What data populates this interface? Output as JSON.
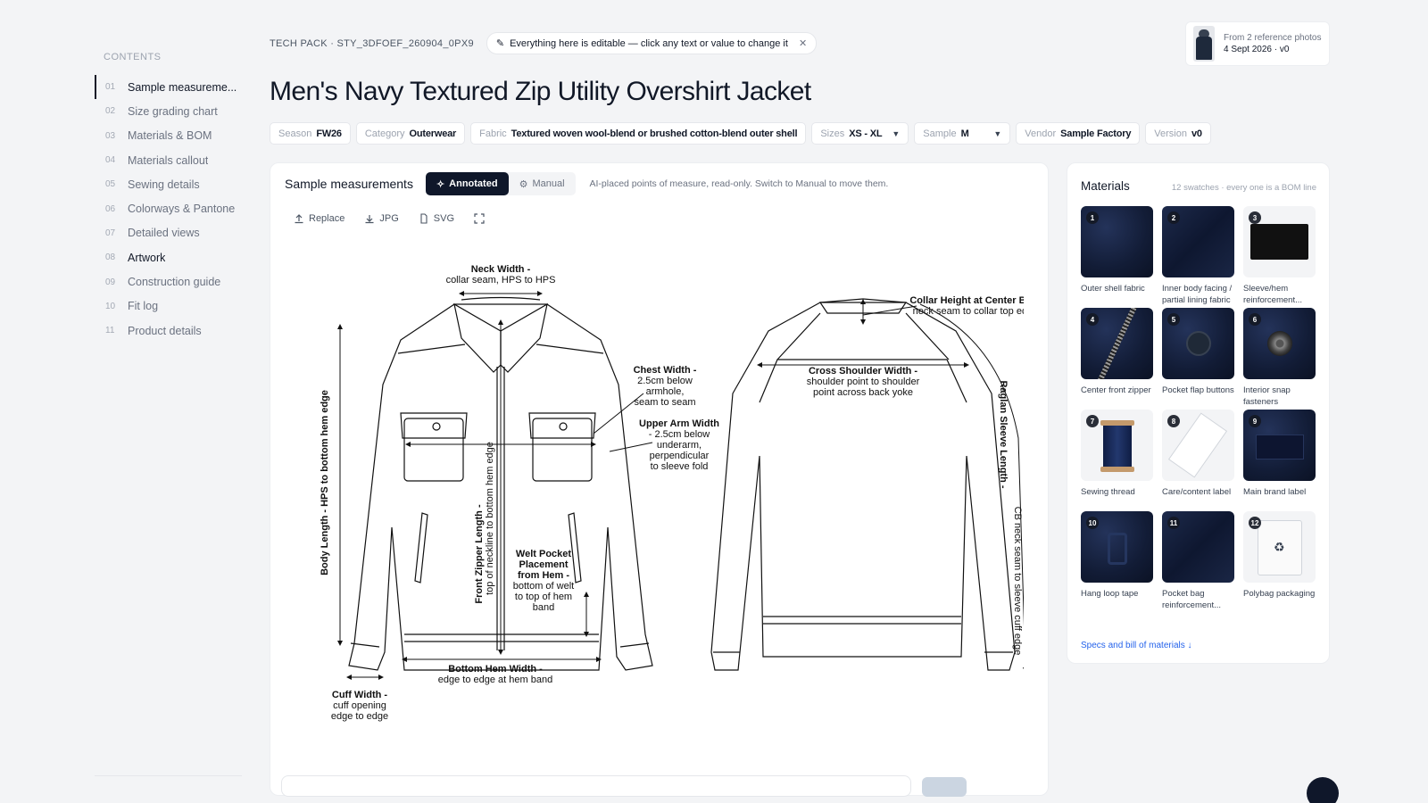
{
  "toc": {
    "heading": "CONTENTS",
    "items": [
      {
        "num": "01",
        "label": "Sample measureme..."
      },
      {
        "num": "02",
        "label": "Size grading chart"
      },
      {
        "num": "03",
        "label": "Materials & BOM"
      },
      {
        "num": "04",
        "label": "Materials callout"
      },
      {
        "num": "05",
        "label": "Sewing details"
      },
      {
        "num": "06",
        "label": "Colorways & Pantone"
      },
      {
        "num": "07",
        "label": "Detailed views"
      },
      {
        "num": "08",
        "label": "Artwork"
      },
      {
        "num": "09",
        "label": "Construction guide"
      },
      {
        "num": "10",
        "label": "Fit log"
      },
      {
        "num": "11",
        "label": "Product details"
      }
    ]
  },
  "header": {
    "crumb": "TECH PACK · STY_3DFOEF_260904_0PX9",
    "edit_hint": "Everything here is editable — click any text or value to change it",
    "title": "Men's Navy Textured Zip Utility Overshirt Jacket",
    "ref_line1": "From 2 reference photos",
    "ref_line2": "4 Sept 2026 · v0"
  },
  "attrs": [
    {
      "key": "Season",
      "value": "FW26"
    },
    {
      "key": "Category",
      "value": "Outerwear"
    },
    {
      "key": "Fabric",
      "value": "Textured woven wool-blend or brushed cotton-blend outer shell"
    },
    {
      "key": "Sizes",
      "value": "XS - XL"
    },
    {
      "key": "Sample",
      "value": "M"
    },
    {
      "key": "Vendor",
      "value": "Sample Factory"
    },
    {
      "key": "Version",
      "value": "v0"
    }
  ],
  "measure": {
    "title": "Sample measurements",
    "annotated": "Annotated",
    "manual": "Manual",
    "hint": "AI-placed points of measure, read-only. Switch to Manual to move them.",
    "tools": {
      "replace": "Replace",
      "jpg": "JPG",
      "svg": "SVG"
    },
    "labels": {
      "neck_1": "Neck Width -",
      "neck_2": "collar seam, HPS to HPS",
      "chest_1": "Chest Width -",
      "chest_2": "2.5cm below",
      "chest_3": "armhole,",
      "chest_4": "seam to seam",
      "arm_1": "Upper Arm Width",
      "arm_2": "- 2.5cm below",
      "arm_3": "underarm,",
      "arm_4": "perpendicular",
      "arm_5": "to sleeve fold",
      "body_len": "Body Length - HPS to bottom hem edge",
      "zip_1": "Front Zipper Length -",
      "zip_2": "top of neckline to bottom hem edge",
      "welt_1": "Welt Pocket",
      "welt_2": "Placement",
      "welt_3": "from Hem -",
      "welt_4": "bottom of welt",
      "welt_5": "to top of hem",
      "welt_6": "band",
      "hem_1": "Bottom Hem Width -",
      "hem_2": "edge to edge at hem band",
      "cuff_1": "Cuff Width -",
      "cuff_2": "cuff opening",
      "cuff_3": "edge to edge",
      "collar_1": "Collar Height at Center Back -",
      "collar_2": "neck seam to collar top edge",
      "shoulder_1": "Cross Shoulder Width -",
      "shoulder_2": "shoulder point to shoulder",
      "shoulder_3": "point across back yoke",
      "raglan_1": "Raglan Sleeve Length -",
      "raglan_2": "CB neck seam to sleeve cuff edge"
    }
  },
  "materials": {
    "title": "Materials",
    "subtitle": "12 swatches · every one is a BOM line",
    "link": "Specs and bill of materials ↓",
    "items": [
      {
        "num": "1",
        "label": "Outer shell fabric",
        "icon": "fabric-swatch"
      },
      {
        "num": "2",
        "label": "Inner body facing / partial lining fabric",
        "icon": "lining-swatch"
      },
      {
        "num": "3",
        "label": "Sleeve/hem reinforcement...",
        "icon": "reinforcement-swatch"
      },
      {
        "num": "4",
        "label": "Center front zipper",
        "icon": "zipper"
      },
      {
        "num": "5",
        "label": "Pocket flap buttons",
        "icon": "button"
      },
      {
        "num": "6",
        "label": "Interior snap fasteners",
        "icon": "snap"
      },
      {
        "num": "7",
        "label": "Sewing thread",
        "icon": "thread-spool"
      },
      {
        "num": "8",
        "label": "Care/content label",
        "icon": "care-label"
      },
      {
        "num": "9",
        "label": "Main brand label",
        "icon": "brand-label"
      },
      {
        "num": "10",
        "label": "Hang loop tape",
        "icon": "hang-loop"
      },
      {
        "num": "11",
        "label": "Pocket bag reinforcement...",
        "icon": "pocket-bag"
      },
      {
        "num": "12",
        "label": "Polybag packaging",
        "icon": "polybag"
      }
    ]
  }
}
